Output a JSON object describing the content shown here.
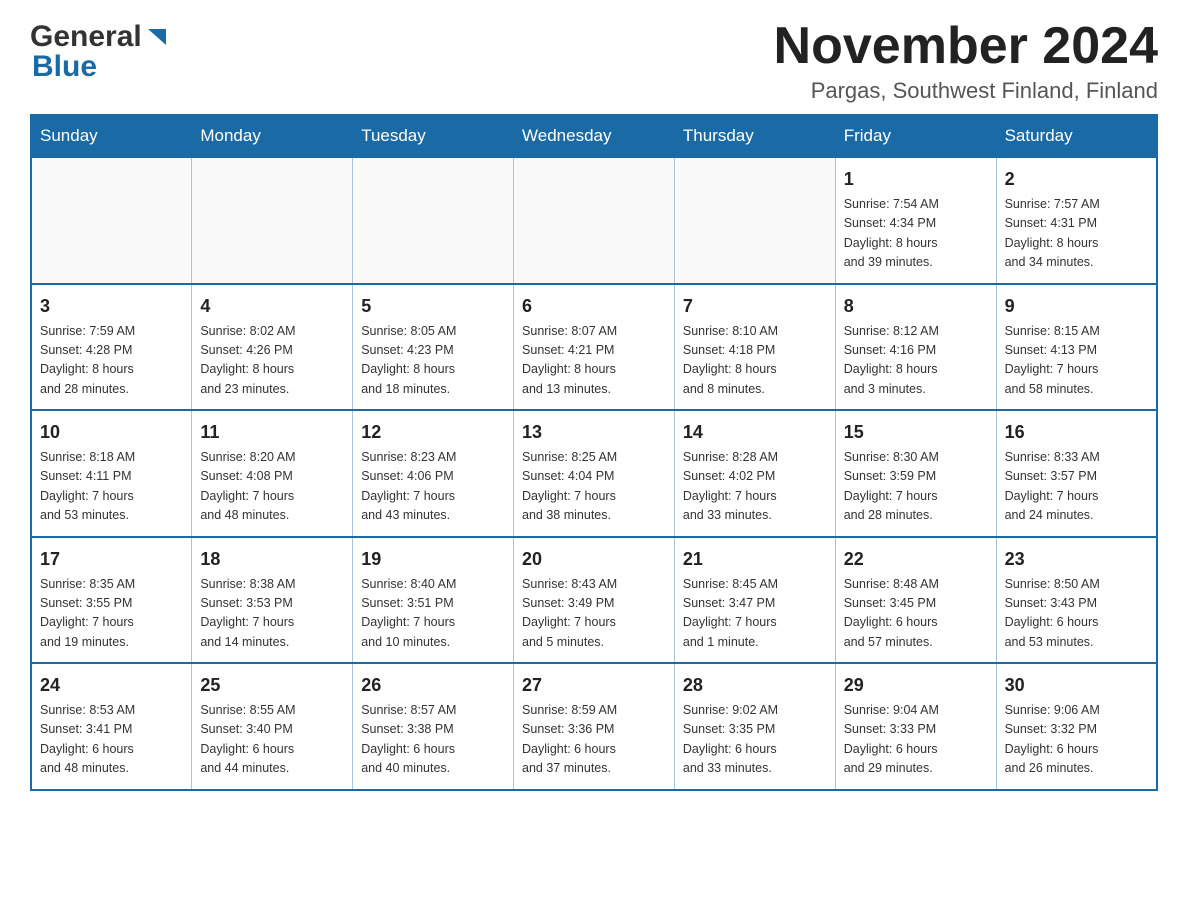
{
  "header": {
    "logo_general": "General",
    "logo_blue": "Blue",
    "month_year": "November 2024",
    "location": "Pargas, Southwest Finland, Finland"
  },
  "days_of_week": [
    "Sunday",
    "Monday",
    "Tuesday",
    "Wednesday",
    "Thursday",
    "Friday",
    "Saturday"
  ],
  "weeks": [
    [
      {
        "day": "",
        "info": ""
      },
      {
        "day": "",
        "info": ""
      },
      {
        "day": "",
        "info": ""
      },
      {
        "day": "",
        "info": ""
      },
      {
        "day": "",
        "info": ""
      },
      {
        "day": "1",
        "info": "Sunrise: 7:54 AM\nSunset: 4:34 PM\nDaylight: 8 hours\nand 39 minutes."
      },
      {
        "day": "2",
        "info": "Sunrise: 7:57 AM\nSunset: 4:31 PM\nDaylight: 8 hours\nand 34 minutes."
      }
    ],
    [
      {
        "day": "3",
        "info": "Sunrise: 7:59 AM\nSunset: 4:28 PM\nDaylight: 8 hours\nand 28 minutes."
      },
      {
        "day": "4",
        "info": "Sunrise: 8:02 AM\nSunset: 4:26 PM\nDaylight: 8 hours\nand 23 minutes."
      },
      {
        "day": "5",
        "info": "Sunrise: 8:05 AM\nSunset: 4:23 PM\nDaylight: 8 hours\nand 18 minutes."
      },
      {
        "day": "6",
        "info": "Sunrise: 8:07 AM\nSunset: 4:21 PM\nDaylight: 8 hours\nand 13 minutes."
      },
      {
        "day": "7",
        "info": "Sunrise: 8:10 AM\nSunset: 4:18 PM\nDaylight: 8 hours\nand 8 minutes."
      },
      {
        "day": "8",
        "info": "Sunrise: 8:12 AM\nSunset: 4:16 PM\nDaylight: 8 hours\nand 3 minutes."
      },
      {
        "day": "9",
        "info": "Sunrise: 8:15 AM\nSunset: 4:13 PM\nDaylight: 7 hours\nand 58 minutes."
      }
    ],
    [
      {
        "day": "10",
        "info": "Sunrise: 8:18 AM\nSunset: 4:11 PM\nDaylight: 7 hours\nand 53 minutes."
      },
      {
        "day": "11",
        "info": "Sunrise: 8:20 AM\nSunset: 4:08 PM\nDaylight: 7 hours\nand 48 minutes."
      },
      {
        "day": "12",
        "info": "Sunrise: 8:23 AM\nSunset: 4:06 PM\nDaylight: 7 hours\nand 43 minutes."
      },
      {
        "day": "13",
        "info": "Sunrise: 8:25 AM\nSunset: 4:04 PM\nDaylight: 7 hours\nand 38 minutes."
      },
      {
        "day": "14",
        "info": "Sunrise: 8:28 AM\nSunset: 4:02 PM\nDaylight: 7 hours\nand 33 minutes."
      },
      {
        "day": "15",
        "info": "Sunrise: 8:30 AM\nSunset: 3:59 PM\nDaylight: 7 hours\nand 28 minutes."
      },
      {
        "day": "16",
        "info": "Sunrise: 8:33 AM\nSunset: 3:57 PM\nDaylight: 7 hours\nand 24 minutes."
      }
    ],
    [
      {
        "day": "17",
        "info": "Sunrise: 8:35 AM\nSunset: 3:55 PM\nDaylight: 7 hours\nand 19 minutes."
      },
      {
        "day": "18",
        "info": "Sunrise: 8:38 AM\nSunset: 3:53 PM\nDaylight: 7 hours\nand 14 minutes."
      },
      {
        "day": "19",
        "info": "Sunrise: 8:40 AM\nSunset: 3:51 PM\nDaylight: 7 hours\nand 10 minutes."
      },
      {
        "day": "20",
        "info": "Sunrise: 8:43 AM\nSunset: 3:49 PM\nDaylight: 7 hours\nand 5 minutes."
      },
      {
        "day": "21",
        "info": "Sunrise: 8:45 AM\nSunset: 3:47 PM\nDaylight: 7 hours\nand 1 minute."
      },
      {
        "day": "22",
        "info": "Sunrise: 8:48 AM\nSunset: 3:45 PM\nDaylight: 6 hours\nand 57 minutes."
      },
      {
        "day": "23",
        "info": "Sunrise: 8:50 AM\nSunset: 3:43 PM\nDaylight: 6 hours\nand 53 minutes."
      }
    ],
    [
      {
        "day": "24",
        "info": "Sunrise: 8:53 AM\nSunset: 3:41 PM\nDaylight: 6 hours\nand 48 minutes."
      },
      {
        "day": "25",
        "info": "Sunrise: 8:55 AM\nSunset: 3:40 PM\nDaylight: 6 hours\nand 44 minutes."
      },
      {
        "day": "26",
        "info": "Sunrise: 8:57 AM\nSunset: 3:38 PM\nDaylight: 6 hours\nand 40 minutes."
      },
      {
        "day": "27",
        "info": "Sunrise: 8:59 AM\nSunset: 3:36 PM\nDaylight: 6 hours\nand 37 minutes."
      },
      {
        "day": "28",
        "info": "Sunrise: 9:02 AM\nSunset: 3:35 PM\nDaylight: 6 hours\nand 33 minutes."
      },
      {
        "day": "29",
        "info": "Sunrise: 9:04 AM\nSunset: 3:33 PM\nDaylight: 6 hours\nand 29 minutes."
      },
      {
        "day": "30",
        "info": "Sunrise: 9:06 AM\nSunset: 3:32 PM\nDaylight: 6 hours\nand 26 minutes."
      }
    ]
  ]
}
